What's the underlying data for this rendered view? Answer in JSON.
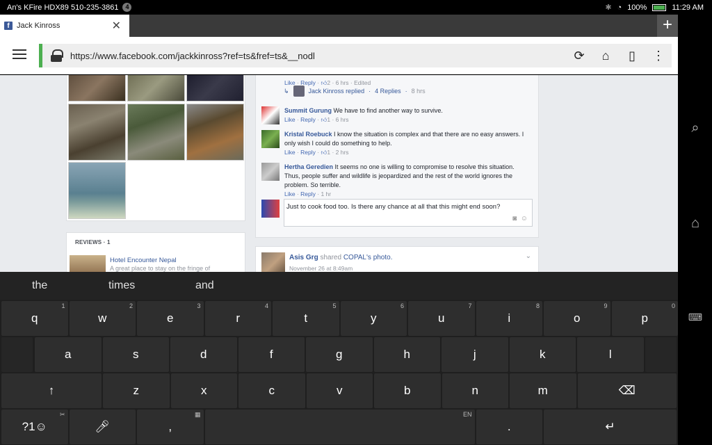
{
  "status_bar": {
    "device_label": "An's KFire HDX89 510-235-3861",
    "notification_count": "4",
    "battery": "100%",
    "time": "11:29 AM"
  },
  "browser": {
    "tab_title": "Jack Kinross",
    "tab_close": "✕",
    "new_tab": "+",
    "url": "https://www.facebook.com/jackkinross?ref=ts&fref=ts&__nodl"
  },
  "left_column": {
    "reviews_label": "REVIEWS · 1",
    "review_title": "Hotel Encounter Nepal",
    "review_snippet": "A great place to stay on the fringe of"
  },
  "comments": {
    "first_meta": {
      "like": "Like",
      "reply": "Reply",
      "count": "2",
      "time": "6 hrs",
      "edited": "Edited"
    },
    "reply_summary": {
      "name": "Jack Kinross replied",
      "replies": "4 Replies",
      "time": "8 hrs"
    },
    "items": [
      {
        "name": "Summit Gurung",
        "text": "We have to find another way to survive.",
        "like": "Like",
        "reply": "Reply",
        "count": "1",
        "time": "6 hrs"
      },
      {
        "name": "Kristal Roebuck",
        "text": "I know the situation is complex and that there are no easy answers. I only wish I could do something to help.",
        "like": "Like",
        "reply": "Reply",
        "count": "1",
        "time": "2 hrs"
      },
      {
        "name": "Hertha Geredien",
        "text": "It seems no one is willing to compromise to resolve this situation. Thus, people suffer and wildlife is jeopardized and the rest of the world ignores the problem. So terrible.",
        "like": "Like",
        "reply": "Reply",
        "time": "1 hr"
      }
    ],
    "draft_text": "Just to cook food too. Is there any chance at all that this might end soon?"
  },
  "next_post": {
    "author": "Asis Grg",
    "action": "shared",
    "source": "COPAL",
    "object": "'s photo.",
    "time": "November 26 at 8:49am"
  },
  "keyboard": {
    "suggestions": [
      "the",
      "times",
      "and"
    ],
    "row1": [
      {
        "k": "q",
        "h": "1"
      },
      {
        "k": "w",
        "h": "2"
      },
      {
        "k": "e",
        "h": "3"
      },
      {
        "k": "r",
        "h": "4"
      },
      {
        "k": "t",
        "h": "5"
      },
      {
        "k": "y",
        "h": "6"
      },
      {
        "k": "u",
        "h": "7"
      },
      {
        "k": "i",
        "h": "8"
      },
      {
        "k": "o",
        "h": "9"
      },
      {
        "k": "p",
        "h": "0"
      }
    ],
    "row2": [
      "a",
      "s",
      "d",
      "f",
      "g",
      "h",
      "j",
      "k",
      "l"
    ],
    "row3": [
      "z",
      "x",
      "c",
      "v",
      "b",
      "n",
      "m"
    ],
    "shift": "↑",
    "backspace": "⌫",
    "symbols": "?1☺",
    "comma": ",",
    "period": ".",
    "enter": "↵",
    "language": "EN"
  }
}
